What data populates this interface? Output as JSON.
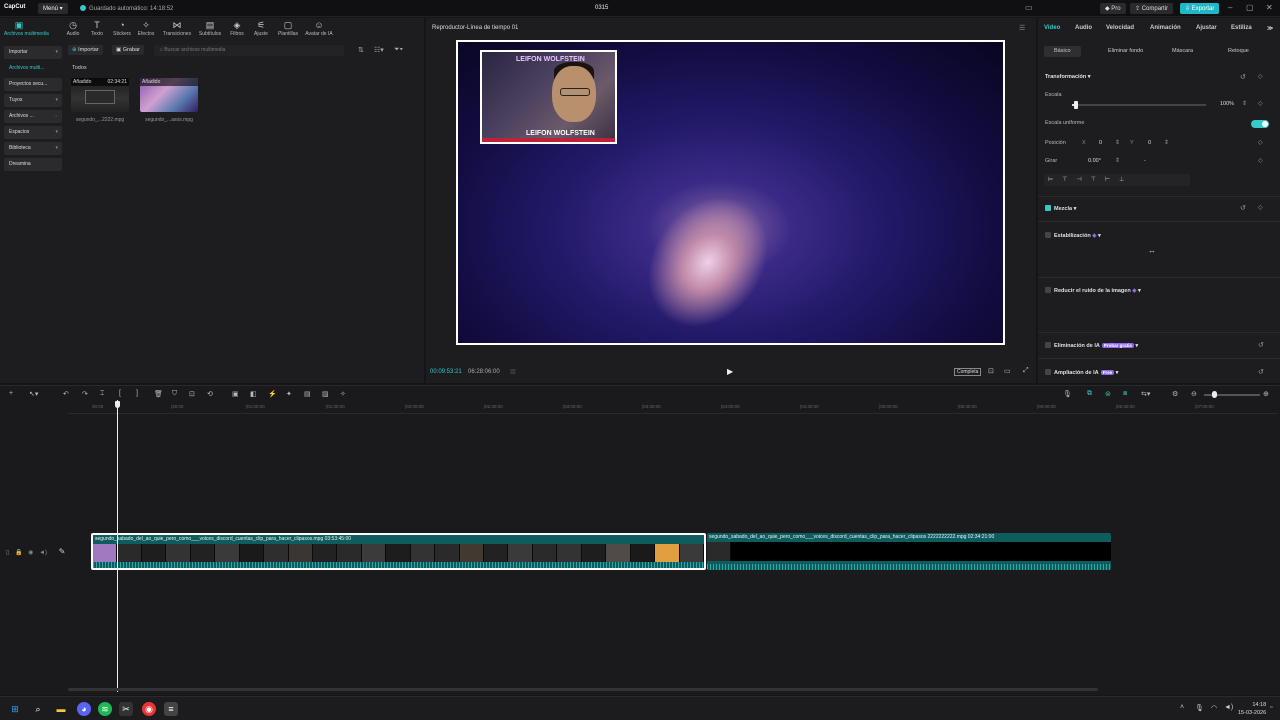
{
  "titlebar": {
    "app_name": "CapCut",
    "menu_label": "Menú",
    "autosave": "Guardado automático: 14:18:52",
    "project_title": "0315",
    "pro_label": "Pro",
    "share_label": "Compartir",
    "export_label": "Exportar",
    "accent_color": "#1fb8c9"
  },
  "toolbar": {
    "items": [
      "Archivos multimedia",
      "Audio",
      "Texto",
      "Stickers",
      "Efectos",
      "Transiciones",
      "Subtítulos",
      "Filtros",
      "Ajuste",
      "Plantillas",
      "Avatar de IA"
    ],
    "icons": [
      "media-icon",
      "audio-icon",
      "text-icon",
      "sticker-icon",
      "effects-icon",
      "transitions-icon",
      "subtitles-icon",
      "filters-icon",
      "adjust-icon",
      "templates-icon",
      "avatar-icon"
    ]
  },
  "sidebar": {
    "items": [
      "Importar",
      "Archivos multi...",
      "Proyectos secu...",
      "Tuyos",
      "Archivos ...",
      "Espacios",
      "Biblioteca",
      "Dreamina"
    ]
  },
  "media": {
    "import_label": "Importar",
    "record_label": "Grabar",
    "search_placeholder": "Buscar archivos multimedia",
    "filter_all": "Todos",
    "items": [
      {
        "badge": "Añadido",
        "duration": "02:34:21",
        "name": "segundo_...2222.mpg"
      },
      {
        "badge": "Añadido",
        "duration": "",
        "name": "segundo_...asos.mpg"
      }
    ]
  },
  "player": {
    "title": "Reproductor-Línea de tiempo 01",
    "current_time": "00:09:53:21",
    "total_time": "06:28:06:00",
    "complete_label": "Completa",
    "cam_logo_top": "LEIFON WOLFSTEIN",
    "cam_logo_bottom": "LEIFON WOLFSTEIN"
  },
  "properties": {
    "tabs": [
      "Video",
      "Audio",
      "Velocidad",
      "Animación",
      "Ajustar",
      "Estiliza"
    ],
    "subtabs": [
      "Básico",
      "Eliminar fondo",
      "Máscara",
      "Retoque"
    ],
    "transform_title": "Transformación",
    "scale_label": "Escala",
    "scale_value": "100%",
    "scale_fraction": 0.02,
    "uniform_label": "Escala uniforme",
    "position_label": "Posición",
    "pos_x_label": "X",
    "pos_x": "0",
    "pos_y_label": "Y",
    "pos_y": "0",
    "rotate_label": "Girar",
    "rotate_value": "0.00°",
    "rotate_dash": "-",
    "blend_title": "Mezcla",
    "stabilize_title": "Estabilización",
    "denoise_title": "Reducir el ruido de la imagen",
    "ai_remove_title": "Eliminación de IA",
    "ai_remove_badge": "Probar gratis",
    "ai_expand_title": "Ampliación de IA",
    "ai_expand_badge": "Free"
  },
  "timeline": {
    "ruler": [
      "00:00",
      "|30:00",
      "|01:00:00",
      "|01:30:00",
      "|02:00:00",
      "|02:30:00",
      "|03:00:00",
      "|03:30:00",
      "|04:00:00",
      "|04:30:00",
      "|05:00:00",
      "|05:30:00",
      "|06:00:00",
      "|06:30:00",
      "|07:00:00"
    ],
    "clip1_name": "segundo_sabado_del_ao_quie_pero_como___voices_discord_cuentas_clip_para_hacer_clipasos.mpg  03:53:45:00",
    "clip2_name": "segundo_sabado_del_ao_quie_pero_como___voices_discord_cuentas_clip_para_hacer_clipasos 2222222222.mpg  02:34:21:00"
  },
  "taskbar": {
    "time": "14:18",
    "date": "15-03-2026",
    "apps": [
      "windows-start-icon",
      "search-icon",
      "file-explorer-icon",
      "discord-icon",
      "spotify-icon",
      "capcut-icon",
      "chrome-icon",
      "notepad-icon"
    ]
  }
}
